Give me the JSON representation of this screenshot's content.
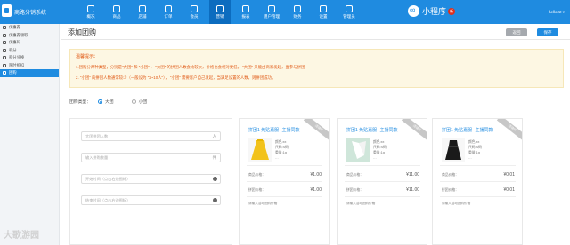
{
  "topbar": {
    "brand": "商路分销系统",
    "nav": [
      {
        "label": "概况",
        "active": false
      },
      {
        "label": "商品",
        "active": false
      },
      {
        "label": "店铺",
        "active": false
      },
      {
        "label": "订单",
        "active": false
      },
      {
        "label": "会员",
        "active": false
      },
      {
        "label": "营销",
        "active": true
      },
      {
        "label": "报表",
        "active": false
      },
      {
        "label": "用户管理",
        "active": false
      },
      {
        "label": "财务",
        "active": false
      },
      {
        "label": "设置",
        "active": false
      },
      {
        "label": "管理员",
        "active": false
      }
    ],
    "miniapp_label": "小程序",
    "miniapp_badge": "新",
    "user": "hello22 ▾"
  },
  "sidebar": {
    "items": [
      {
        "label": "优惠券",
        "active": false
      },
      {
        "label": "优惠券领取",
        "active": false
      },
      {
        "label": "优惠码",
        "active": false
      },
      {
        "label": "积分",
        "active": false
      },
      {
        "label": "积分兑换",
        "active": false
      },
      {
        "label": "限时折扣",
        "active": false
      },
      {
        "label": "团购",
        "active": true
      }
    ]
  },
  "page": {
    "title": "添加团购",
    "return_label": "返回",
    "save_label": "保存"
  },
  "tips": {
    "title": "温馨提示：",
    "line1": "1.团购分两种类型，分别是\"大团\" 和 \"小团\" ， \"大团\" 的拼团人数会比较大，价格也会相对更低， \"大团\" 只能由商家发起，当参与拼团",
    "line2": "2. \"小团\" 的拼团人数通常较少（一般设为 \"2~10人\"）， \"小团\" 需要客户自己发起，当满足设置的人数，则拼团成功。"
  },
  "group_type": {
    "label": "团购类型：",
    "options": [
      "大团",
      "小团"
    ],
    "selected": "大团"
  },
  "form": {
    "fields": [
      {
        "placeholder": "大团拼团人数",
        "suffix": "人"
      },
      {
        "placeholder": "输入拼购数量",
        "suffix": "件"
      },
      {
        "placeholder": "开始时间（点击右边图标）",
        "suffix": ""
      },
      {
        "placeholder": "结束时间（点击右边图标）",
        "suffix": ""
      }
    ]
  },
  "products": [
    {
      "title": "拼团1 免贴嘉服--主播同款",
      "ribbon": "活动价",
      "image_icon": "yellow-dress",
      "specs": [
        "颜色:xx",
        "尺码:S码",
        "重量:1g",
        "…"
      ],
      "price_label": "商品价格：",
      "price": "¥1.00",
      "group_label": "拼团价格：",
      "group_price": "¥1.00",
      "notice": "请输入活动团购价格"
    },
    {
      "title": "拼团1 免贴嘉服--主播同款",
      "ribbon": "活动价",
      "image_icon": "white-shirt",
      "specs": [
        "颜色:xx",
        "尺码:S码",
        "重量:1g",
        "…"
      ],
      "price_label": "商品价格：",
      "price": "¥11.00",
      "group_label": "拼团价格：",
      "group_price": "¥11.00",
      "notice": "请输入活动团购价格"
    },
    {
      "title": "拼团1 免贴嘉服--主播同款",
      "ribbon": "活动价",
      "image_icon": "black-dress",
      "specs": [
        "颜色:xx",
        "尺码:S码",
        "重量:1g",
        "…"
      ],
      "price_label": "商品价格：",
      "price": "¥0.01",
      "group_label": "拼团价格：",
      "group_price": "¥0.01",
      "notice": "请输入活动团购价格"
    }
  ],
  "watermark": "大歌游园",
  "colors": {
    "accent": "#1f8be0",
    "tip_text": "#e05a16",
    "tip_bg": "#fdf7e3"
  }
}
